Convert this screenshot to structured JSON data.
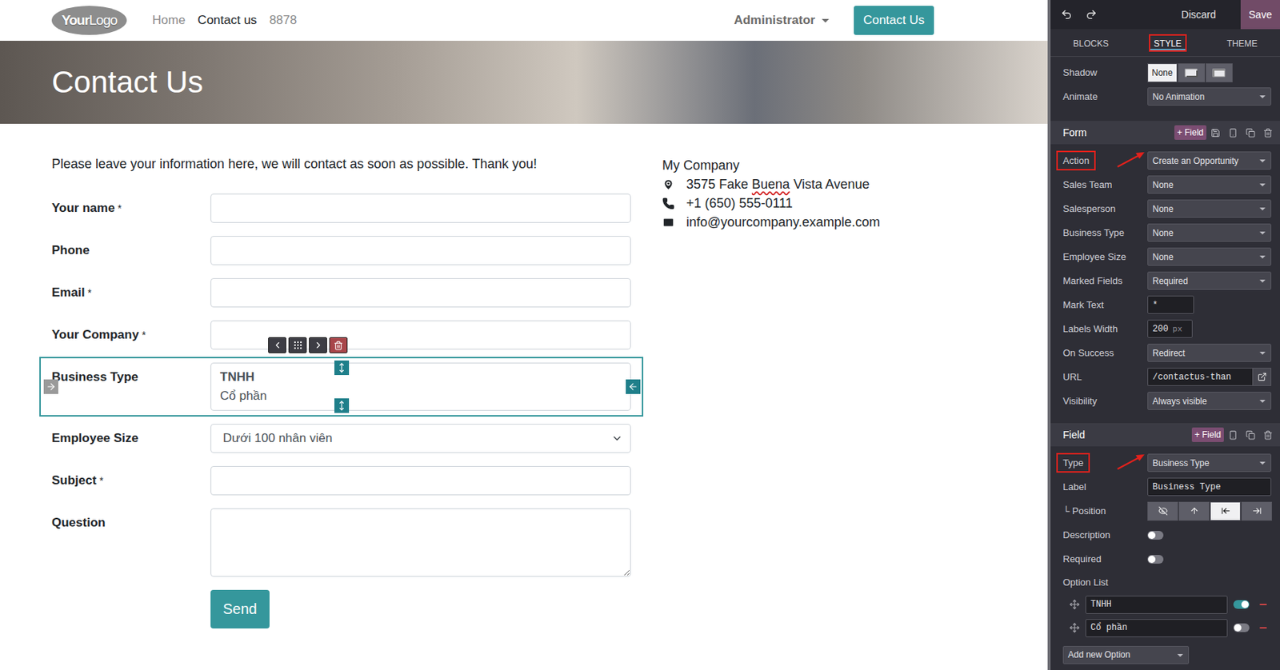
{
  "navbar": {
    "logo": {
      "bold": "Your",
      "rest": "Logo"
    },
    "links": [
      {
        "label": "Home",
        "selected": false
      },
      {
        "label": "Contact us",
        "selected": true
      },
      {
        "label": "8878",
        "selected": false
      }
    ],
    "user": "Administrator",
    "cta": "Contact Us"
  },
  "banner": {
    "title": "Contact Us"
  },
  "intro": "Please leave your information here, we will contact as soon as possible. Thank you!",
  "form": {
    "mark": "*",
    "fields": [
      {
        "label": "Your name",
        "required": true,
        "kind": "text",
        "value": "",
        "editing": false
      },
      {
        "label": "Phone",
        "required": false,
        "kind": "text",
        "value": "",
        "editing": false
      },
      {
        "label": "Email",
        "required": true,
        "kind": "text",
        "value": "",
        "editing": false
      },
      {
        "label": "Your Company",
        "required": true,
        "kind": "text",
        "value": "",
        "editing": false
      },
      {
        "label": "Business Type",
        "required": false,
        "kind": "listbox",
        "editing": true,
        "options": [
          {
            "text": "TNHH",
            "selected": true
          },
          {
            "text": "Cổ phần",
            "selected": false
          }
        ]
      },
      {
        "label": "Employee Size",
        "required": false,
        "kind": "select",
        "value": "Dưới 100 nhân viên",
        "editing": false
      },
      {
        "label": "Subject",
        "required": true,
        "kind": "text",
        "value": "",
        "editing": false
      },
      {
        "label": "Question",
        "required": false,
        "kind": "textarea",
        "value": "",
        "editing": false
      }
    ],
    "submit": "Send"
  },
  "company": {
    "name": "My Company",
    "address": [
      {
        "text": "3575 Fake ",
        "misspelled": false
      },
      {
        "text": "Buena",
        "misspelled": true
      },
      {
        "text": " Vista Avenue",
        "misspelled": false
      }
    ],
    "phone": "+1 (650) 555-0111",
    "email": "info@yourcompany.example.com"
  },
  "editor": {
    "discard": "Discard",
    "save": "Save",
    "tabs": [
      {
        "label": "BLOCKS",
        "selected": false,
        "annotated": false
      },
      {
        "label": "STYLE",
        "selected": true,
        "annotated": true
      },
      {
        "label": "THEME",
        "selected": false,
        "annotated": false
      }
    ],
    "appearance": [
      {
        "kind": "shadow",
        "label": "Shadow",
        "annotated": false,
        "choices": [
          {
            "kind": "label",
            "text": "None",
            "selected": true
          },
          {
            "kind": "icon",
            "text": "",
            "selected": false
          },
          {
            "kind": "icon",
            "text": "",
            "selected": false
          }
        ]
      },
      {
        "kind": "select",
        "label": "Animate",
        "value": "No Animation",
        "annotated": false
      }
    ],
    "sections": [
      {
        "title": "Form",
        "add": "+ Field",
        "savable": true,
        "rows": [
          {
            "kind": "select",
            "label": "Action",
            "value": "Create an Opportunity",
            "annotated": true
          },
          {
            "kind": "select",
            "label": "Sales Team",
            "value": "None",
            "annotated": false
          },
          {
            "kind": "select",
            "label": "Salesperson",
            "value": "None",
            "annotated": false
          },
          {
            "kind": "select",
            "label": "Business Type",
            "value": "None",
            "annotated": false
          },
          {
            "kind": "select",
            "label": "Employee Size",
            "value": "None",
            "annotated": false
          },
          {
            "kind": "select",
            "label": "Marked Fields",
            "value": "Required",
            "annotated": false
          },
          {
            "kind": "short",
            "label": "Mark Text",
            "value": "*",
            "annotated": false
          },
          {
            "kind": "unit",
            "label": "Labels Width",
            "value": "200",
            "unit": "px",
            "annotated": false
          },
          {
            "kind": "select",
            "label": "On Success",
            "value": "Redirect",
            "annotated": false
          },
          {
            "kind": "url",
            "label": "URL",
            "value": "/contactus-than",
            "annotated": false
          },
          {
            "kind": "select",
            "label": "Visibility",
            "value": "Always visible",
            "annotated": false
          }
        ]
      },
      {
        "title": "Field",
        "add": "+ Field",
        "savable": false,
        "rows": [
          {
            "kind": "select",
            "label": "Type",
            "value": "Business Type",
            "annotated": true
          },
          {
            "kind": "text",
            "label": "Label",
            "value": "Business Type",
            "annotated": false
          },
          {
            "kind": "position",
            "label": "└ Position",
            "annotated": false,
            "choices": [
              {
                "kind": "icon",
                "text": "",
                "selected": false
              },
              {
                "kind": "icon",
                "text": "",
                "selected": false
              },
              {
                "kind": "icon",
                "text": "",
                "selected": true
              },
              {
                "kind": "icon",
                "text": "",
                "selected": false
              }
            ]
          },
          {
            "kind": "toggle",
            "label": "Description",
            "on": false,
            "annotated": false
          },
          {
            "kind": "toggle",
            "label": "Required",
            "on": false,
            "annotated": false
          },
          {
            "kind": "heading",
            "label": "Option List",
            "annotated": false
          },
          {
            "kind": "option",
            "text": "TNHH",
            "on": true,
            "annotated": false
          },
          {
            "kind": "option",
            "text": "Cổ phần",
            "on": false,
            "annotated": false
          },
          {
            "kind": "addselect",
            "text": "Add new Option",
            "annotated": false
          }
        ]
      }
    ]
  }
}
